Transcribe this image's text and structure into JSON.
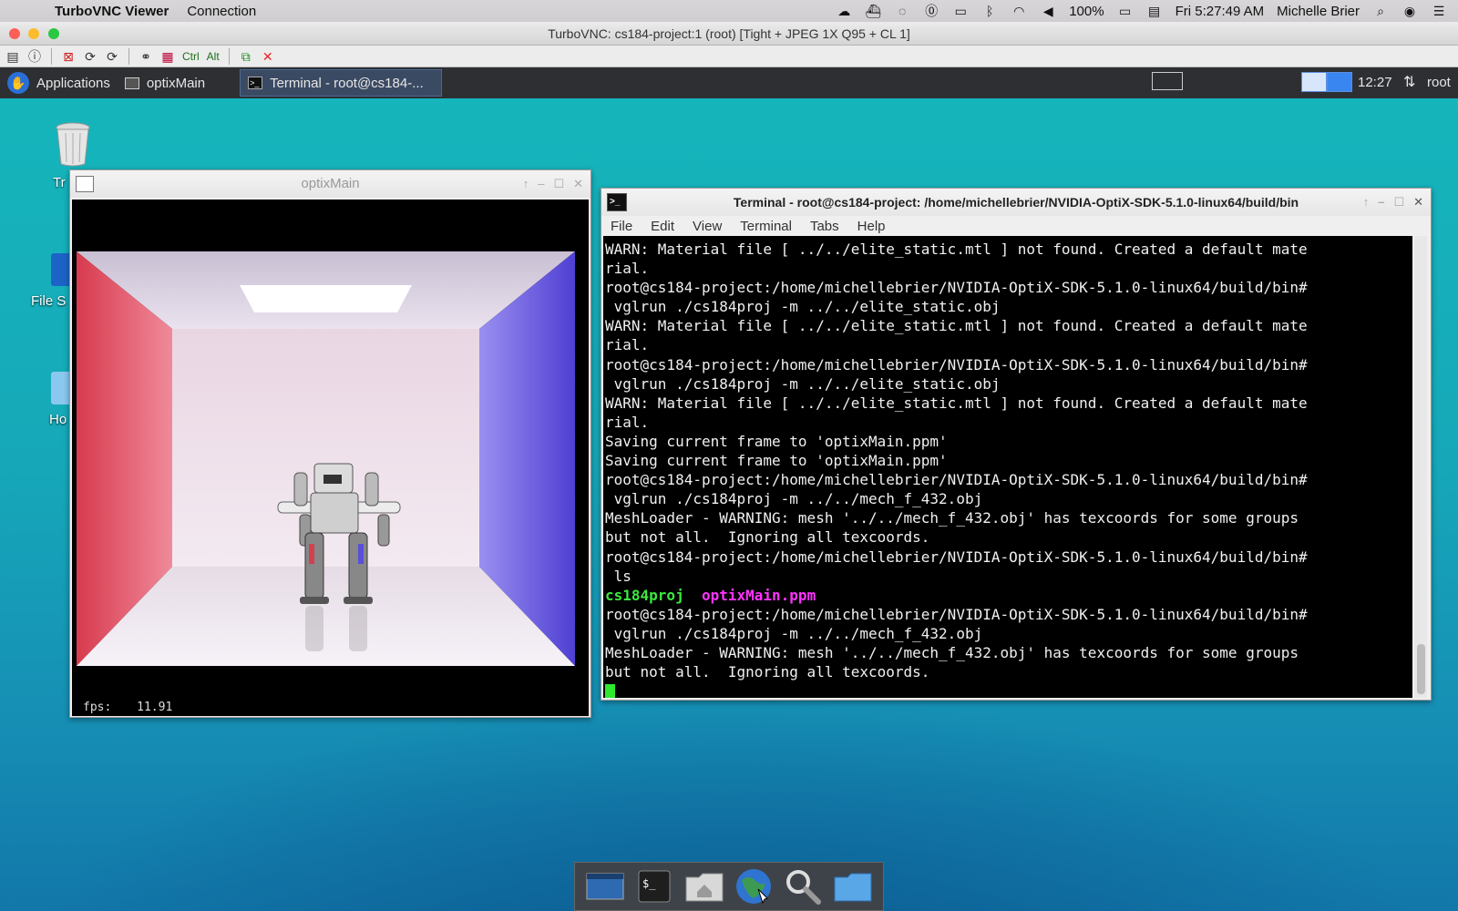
{
  "mac_menubar": {
    "app_name": "TurboVNC Viewer",
    "menu_connection": "Connection",
    "battery": "100%",
    "clock": "Fri 5:27:49 AM",
    "user": "Michelle Brier"
  },
  "vnc": {
    "title": "TurboVNC: cs184-project:1 (root) [Tight + JPEG 1X Q95 + CL 1]",
    "toolbar_ctrl": "Ctrl",
    "toolbar_alt": "Alt"
  },
  "panel": {
    "applications": "Applications",
    "task_optix": "optixMain",
    "task_terminal": "Terminal - root@cs184-...",
    "clock": "12:27",
    "user": "root"
  },
  "desktop_icons": {
    "trash": "Tr",
    "filesystem": "File S",
    "home": "Ho"
  },
  "optix_window": {
    "title": "optixMain",
    "fps_label": "fps:",
    "fps_value": "11.91"
  },
  "terminal_window": {
    "title": "Terminal - root@cs184-project: /home/michellebrier/NVIDIA-OptiX-SDK-5.1.0-linux64/build/bin",
    "menu": [
      "File",
      "Edit",
      "View",
      "Terminal",
      "Tabs",
      "Help"
    ],
    "lines": [
      "WARN: Material file [ ../../elite_static.mtl ] not found. Created a default mate",
      "rial.",
      "root@cs184-project:/home/michellebrier/NVIDIA-OptiX-SDK-5.1.0-linux64/build/bin#",
      " vglrun ./cs184proj -m ../../elite_static.obj",
      "WARN: Material file [ ../../elite_static.mtl ] not found. Created a default mate",
      "rial.",
      "root@cs184-project:/home/michellebrier/NVIDIA-OptiX-SDK-5.1.0-linux64/build/bin#",
      " vglrun ./cs184proj -m ../../elite_static.obj",
      "WARN: Material file [ ../../elite_static.mtl ] not found. Created a default mate",
      "rial.",
      "Saving current frame to 'optixMain.ppm'",
      "Saving current frame to 'optixMain.ppm'",
      "root@cs184-project:/home/michellebrier/NVIDIA-OptiX-SDK-5.1.0-linux64/build/bin#",
      " vglrun ./cs184proj -m ../../mech_f_432.obj",
      "MeshLoader - WARNING: mesh '../../mech_f_432.obj' has texcoords for some groups",
      "but not all.  Ignoring all texcoords.",
      "root@cs184-project:/home/michellebrier/NVIDIA-OptiX-SDK-5.1.0-linux64/build/bin#",
      " ls"
    ],
    "ls_a": "cs184proj",
    "ls_b": "optixMain.ppm",
    "lines_after": [
      "root@cs184-project:/home/michellebrier/NVIDIA-OptiX-SDK-5.1.0-linux64/build/bin#",
      " vglrun ./cs184proj -m ../../mech_f_432.obj",
      "MeshLoader - WARNING: mesh '../../mech_f_432.obj' has texcoords for some groups",
      "but not all.  Ignoring all texcoords."
    ]
  },
  "dock": [
    "show-desktop-icon",
    "terminal-icon",
    "home-folder-icon",
    "web-browser-icon",
    "search-icon",
    "files-icon"
  ]
}
